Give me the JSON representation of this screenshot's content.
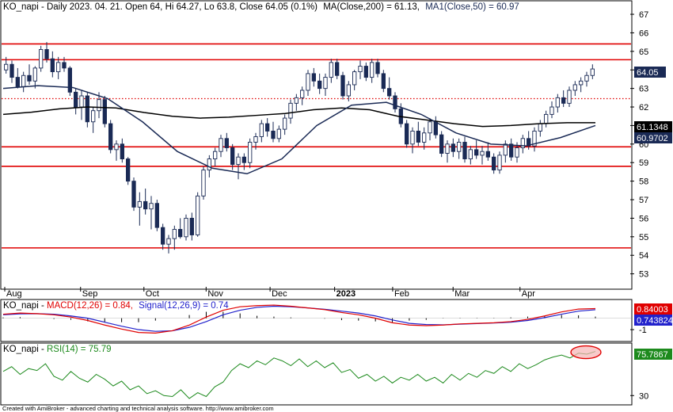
{
  "header": {
    "main_title": "KO_napi - Daily 2023. 04. 21. Open 64, Hi 64.27, Lo 63.8, Close 64.05 (0.1%)",
    "main_ma200": "MA(Close,200) = 61.13,",
    "main_ma50": "MA1(Close,50) = 60.97",
    "macd_prefix": "KO_napi - ",
    "macd_main": "MACD(12,26) = 0.84,",
    "macd_signal": "Signal(12,26,9) = 0.74",
    "rsi_prefix": "KO_napi - ",
    "rsi_main": "RSI(14) = 75.79"
  },
  "footer": "Created with AmiBroker - advanced charting and technical analysis software. http://www.amibroker.com",
  "colors": {
    "ma200": "#000000",
    "ma50": "#1a2a55",
    "candle": "#1a2a55",
    "support": "#e00000",
    "macd": "#e00000",
    "signal": "#2222cc",
    "rsi": "#1d8a1d",
    "price_tag": "#1a2a55"
  },
  "value_tags": {
    "price": "64.05",
    "ma200": "61.1348",
    "ma50": "60.9702",
    "macd": "0.84003",
    "signal": "0.743824",
    "rsi": "75.7867"
  },
  "chart_data": [
    {
      "type": "candlestick",
      "x_tick_labels": [
        "Aug",
        "Sep",
        "Oct",
        "Nov",
        "Dec",
        "2023",
        "Feb",
        "Mar",
        "Apr"
      ],
      "y_ticks": [
        53,
        54,
        55,
        56,
        57,
        58,
        59,
        60,
        61,
        62,
        63,
        64,
        65,
        66,
        67
      ],
      "ylim": [
        52.3,
        67.6
      ],
      "horizontal_lines": [
        {
          "value": 65.4,
          "style": "solid"
        },
        {
          "value": 64.55,
          "style": "solid"
        },
        {
          "value": 62.45,
          "style": "dotted"
        },
        {
          "value": 59.85,
          "style": "solid"
        },
        {
          "value": 58.8,
          "style": "solid"
        },
        {
          "value": 54.4,
          "style": "solid"
        }
      ],
      "ma200": [
        61.6,
        61.72,
        61.9,
        62.0,
        61.95,
        61.7,
        61.5,
        61.4,
        61.45,
        61.55,
        61.65,
        61.85,
        61.95,
        61.85,
        61.5,
        61.3,
        61.1,
        60.95,
        61.0,
        61.1,
        61.15,
        61.15
      ],
      "ma50": [
        63.0,
        63.15,
        63.05,
        62.45,
        61.2,
        59.6,
        58.7,
        58.4,
        59.2,
        61.0,
        62.1,
        62.25,
        61.6,
        60.6,
        60.0,
        59.9,
        60.35,
        61.0
      ],
      "candles": [
        [
          64.0,
          64.7,
          63.8,
          64.3
        ],
        [
          64.3,
          64.5,
          63.3,
          63.6
        ],
        [
          63.6,
          64.1,
          63.0,
          63.1
        ],
        [
          63.1,
          63.9,
          62.8,
          63.7
        ],
        [
          63.7,
          64.3,
          63.2,
          63.4
        ],
        [
          63.4,
          64.2,
          63.0,
          64.1
        ],
        [
          64.1,
          65.3,
          63.9,
          65.1
        ],
        [
          65.1,
          65.5,
          64.4,
          64.6
        ],
        [
          64.6,
          65.0,
          63.6,
          63.9
        ],
        [
          63.9,
          64.7,
          63.5,
          64.4
        ],
        [
          64.4,
          64.7,
          63.9,
          64.1
        ],
        [
          64.1,
          64.2,
          62.6,
          62.8
        ],
        [
          62.8,
          63.0,
          61.6,
          62.0
        ],
        [
          62.0,
          62.9,
          61.3,
          62.6
        ],
        [
          62.6,
          62.8,
          60.9,
          61.2
        ],
        [
          61.2,
          62.0,
          60.6,
          61.8
        ],
        [
          61.8,
          62.8,
          61.4,
          62.4
        ],
        [
          62.4,
          62.6,
          60.9,
          61.1
        ],
        [
          61.1,
          61.3,
          59.5,
          59.7
        ],
        [
          59.7,
          60.2,
          59.1,
          60.0
        ],
        [
          60.0,
          60.3,
          59.0,
          59.2
        ],
        [
          59.2,
          59.3,
          57.8,
          58.0
        ],
        [
          58.0,
          58.2,
          56.4,
          56.6
        ],
        [
          56.6,
          57.4,
          55.6,
          56.9
        ],
        [
          56.9,
          57.6,
          56.2,
          56.5
        ],
        [
          56.5,
          57.2,
          55.4,
          56.8
        ],
        [
          56.8,
          57.0,
          55.3,
          55.5
        ],
        [
          55.5,
          55.7,
          54.3,
          54.6
        ],
        [
          54.6,
          55.1,
          54.1,
          54.9
        ],
        [
          54.9,
          55.6,
          54.3,
          55.4
        ],
        [
          55.4,
          56.0,
          54.9,
          55.0
        ],
        [
          55.0,
          56.2,
          54.8,
          56.0
        ],
        [
          56.0,
          56.3,
          54.8,
          55.1
        ],
        [
          55.1,
          57.4,
          55.0,
          57.2
        ],
        [
          57.2,
          58.8,
          57.0,
          58.6
        ],
        [
          58.6,
          59.4,
          58.2,
          59.2
        ],
        [
          59.2,
          59.8,
          58.8,
          59.6
        ],
        [
          59.6,
          60.5,
          59.3,
          60.3
        ],
        [
          60.3,
          60.6,
          59.6,
          59.8
        ],
        [
          59.8,
          60.0,
          58.6,
          58.9
        ],
        [
          58.9,
          59.5,
          58.1,
          59.3
        ],
        [
          59.3,
          59.5,
          58.6,
          59.0
        ],
        [
          59.0,
          60.3,
          58.7,
          60.1
        ],
        [
          60.1,
          60.6,
          59.7,
          60.4
        ],
        [
          60.4,
          61.3,
          60.1,
          61.1
        ],
        [
          61.1,
          61.4,
          60.4,
          60.7
        ],
        [
          60.7,
          61.2,
          60.1,
          60.3
        ],
        [
          60.3,
          61.0,
          60.1,
          60.8
        ],
        [
          60.8,
          61.6,
          60.5,
          61.4
        ],
        [
          61.4,
          62.4,
          61.1,
          62.2
        ],
        [
          62.2,
          62.7,
          61.8,
          62.5
        ],
        [
          62.5,
          63.1,
          62.1,
          62.9
        ],
        [
          62.9,
          64.0,
          62.6,
          63.8
        ],
        [
          63.8,
          64.1,
          63.1,
          63.4
        ],
        [
          63.4,
          63.8,
          62.7,
          63.0
        ],
        [
          63.0,
          63.8,
          62.6,
          63.6
        ],
        [
          63.6,
          64.6,
          63.3,
          64.4
        ],
        [
          64.4,
          64.6,
          63.5,
          63.7
        ],
        [
          63.7,
          63.9,
          62.4,
          62.6
        ],
        [
          62.6,
          63.4,
          62.3,
          63.2
        ],
        [
          63.2,
          64.0,
          62.9,
          63.9
        ],
        [
          63.9,
          64.5,
          63.5,
          64.2
        ],
        [
          64.2,
          64.4,
          63.4,
          63.6
        ],
        [
          63.6,
          64.6,
          63.3,
          64.4
        ],
        [
          64.4,
          64.6,
          63.6,
          63.8
        ],
        [
          63.8,
          64.0,
          62.8,
          63.0
        ],
        [
          63.0,
          63.6,
          62.4,
          62.6
        ],
        [
          62.6,
          62.8,
          61.7,
          61.9
        ],
        [
          61.9,
          62.2,
          60.9,
          61.1
        ],
        [
          61.1,
          61.3,
          59.8,
          60.0
        ],
        [
          60.0,
          60.9,
          59.5,
          60.7
        ],
        [
          60.7,
          61.2,
          59.9,
          60.1
        ],
        [
          60.1,
          60.9,
          59.7,
          60.6
        ],
        [
          60.6,
          61.4,
          60.2,
          61.2
        ],
        [
          61.2,
          61.5,
          60.3,
          60.5
        ],
        [
          60.5,
          60.7,
          59.3,
          59.5
        ],
        [
          59.5,
          60.2,
          59.0,
          60.0
        ],
        [
          60.0,
          60.3,
          59.3,
          59.6
        ],
        [
          59.6,
          60.3,
          59.2,
          60.1
        ],
        [
          60.1,
          60.4,
          59.0,
          59.2
        ],
        [
          59.2,
          59.9,
          58.9,
          59.7
        ],
        [
          59.7,
          60.2,
          59.2,
          59.4
        ],
        [
          59.4,
          59.9,
          58.9,
          59.6
        ],
        [
          59.6,
          60.1,
          59.1,
          59.3
        ],
        [
          59.3,
          59.5,
          58.4,
          58.6
        ],
        [
          58.6,
          59.6,
          58.4,
          59.4
        ],
        [
          59.4,
          60.2,
          59.0,
          60.0
        ],
        [
          60.0,
          60.3,
          59.1,
          59.3
        ],
        [
          59.3,
          60.1,
          59.0,
          59.8
        ],
        [
          59.8,
          60.5,
          59.5,
          60.3
        ],
        [
          60.3,
          60.7,
          59.7,
          59.9
        ],
        [
          59.9,
          60.9,
          59.6,
          60.7
        ],
        [
          60.7,
          61.3,
          60.4,
          61.1
        ],
        [
          61.1,
          61.8,
          60.9,
          61.6
        ],
        [
          61.6,
          62.3,
          61.4,
          62.0
        ],
        [
          62.0,
          62.7,
          61.7,
          62.5
        ],
        [
          62.5,
          62.9,
          62.0,
          62.2
        ],
        [
          62.2,
          63.1,
          62.0,
          62.9
        ],
        [
          62.9,
          63.4,
          62.6,
          63.2
        ],
        [
          63.2,
          63.6,
          62.8,
          63.4
        ],
        [
          63.4,
          63.9,
          63.1,
          63.7
        ],
        [
          63.7,
          64.3,
          63.5,
          64.05
        ]
      ]
    },
    {
      "type": "line",
      "indicator": "MACD",
      "y_ticks": [
        -1
      ],
      "ylim": [
        -1.9,
        1.5
      ],
      "macd": [
        0.35,
        0.45,
        0.4,
        0.3,
        0.1,
        -0.2,
        -0.6,
        -0.95,
        -1.25,
        -1.3,
        -1.1,
        -0.6,
        0.1,
        0.7,
        1.0,
        1.1,
        1.15,
        1.05,
        0.9,
        0.75,
        0.5,
        0.3,
        0.0,
        -0.4,
        -0.6,
        -0.65,
        -0.6,
        -0.5,
        -0.45,
        -0.4,
        -0.3,
        -0.1,
        0.2,
        0.55,
        0.8,
        0.84
      ],
      "signal": [
        0.3,
        0.38,
        0.4,
        0.35,
        0.2,
        0.0,
        -0.35,
        -0.7,
        -1.0,
        -1.15,
        -1.1,
        -0.8,
        -0.3,
        0.3,
        0.7,
        0.95,
        1.05,
        1.0,
        0.9,
        0.78,
        0.62,
        0.45,
        0.2,
        -0.15,
        -0.45,
        -0.55,
        -0.58,
        -0.52,
        -0.47,
        -0.42,
        -0.35,
        -0.2,
        0.05,
        0.35,
        0.62,
        0.74
      ]
    },
    {
      "type": "line",
      "indicator": "RSI",
      "y_ticks": [
        30
      ],
      "ylim": [
        22,
        82
      ],
      "rsi": [
        55,
        60,
        52,
        58,
        56,
        63,
        50,
        46,
        55,
        48,
        44,
        52,
        47,
        40,
        45,
        36,
        40,
        32,
        35,
        30,
        29,
        36,
        27,
        33,
        29,
        39,
        44,
        56,
        63,
        59,
        66,
        62,
        69,
        66,
        61,
        68,
        60,
        66,
        59,
        64,
        54,
        57,
        48,
        52,
        45,
        50,
        43,
        49,
        46,
        52,
        45,
        49,
        43,
        52,
        46,
        53,
        49,
        56,
        53,
        60,
        55,
        63,
        58,
        62,
        67,
        70,
        72,
        69,
        74,
        73,
        75.79
      ]
    }
  ]
}
